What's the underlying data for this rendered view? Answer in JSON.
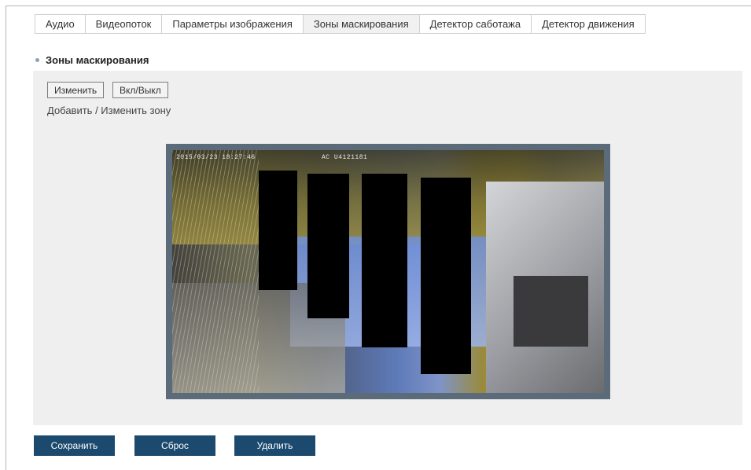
{
  "tabs": [
    {
      "label": "Аудио",
      "active": false
    },
    {
      "label": "Видеопоток",
      "active": false
    },
    {
      "label": "Параметры изображения",
      "active": false
    },
    {
      "label": "Зоны маскирования",
      "active": true
    },
    {
      "label": "Детектор саботажа",
      "active": false
    },
    {
      "label": "Детектор движения",
      "active": false
    }
  ],
  "section": {
    "title": "Зоны маскирования"
  },
  "panel": {
    "edit_button": "Изменить",
    "toggle_button": "Вкл/Выкл",
    "hint": "Добавить / Изменить зону"
  },
  "video": {
    "osd_datetime": "2015/03/23 18:27:46",
    "osd_camera": "AC U4121181",
    "mask_color": "#000000"
  },
  "actions": {
    "save": "Сохранить",
    "reset": "Сброс",
    "delete": "Удалить"
  },
  "colors": {
    "primary_button": "#1c4a6e",
    "panel_bg": "#efefef",
    "video_border": "#5b6b7a"
  }
}
